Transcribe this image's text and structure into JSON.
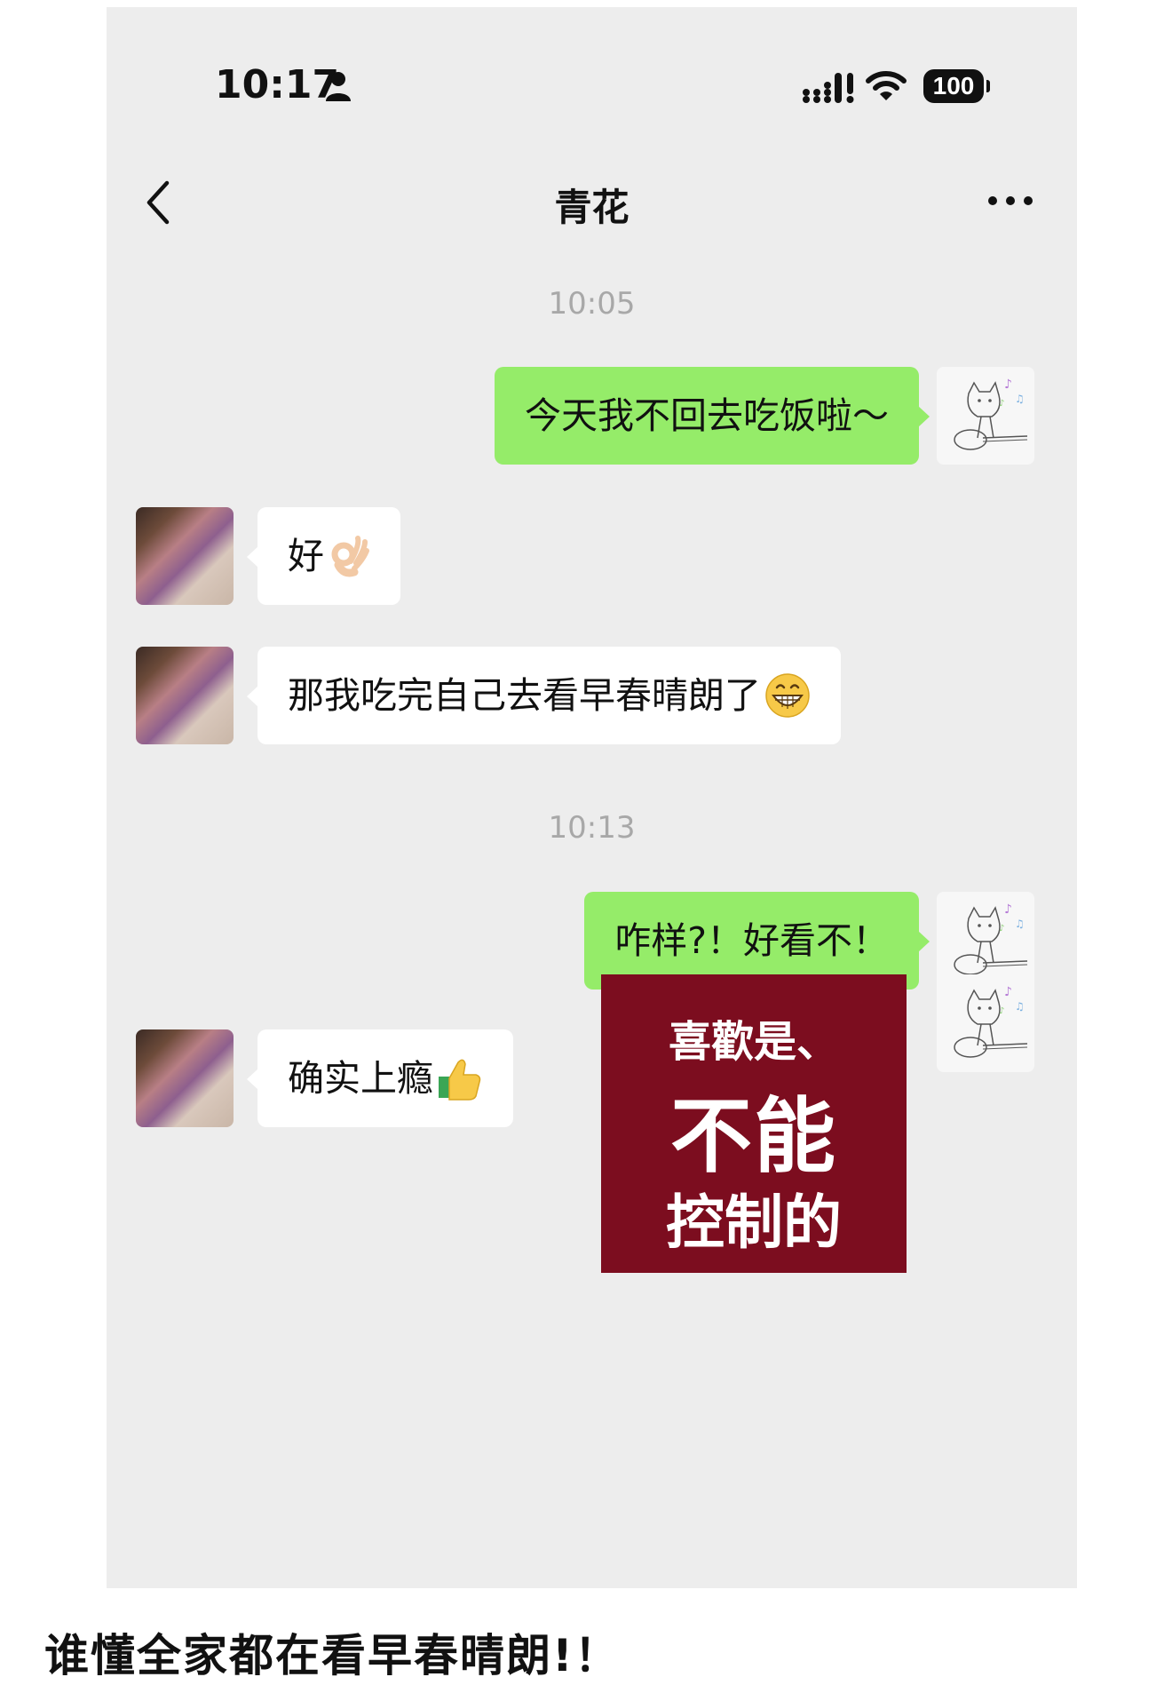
{
  "status_bar": {
    "time": "10:17",
    "battery": "100"
  },
  "nav": {
    "title": "青花"
  },
  "messages": [
    {
      "type": "timestamp",
      "text": "10:05"
    },
    {
      "type": "sent",
      "text": "今天我不回去吃饭啦～"
    },
    {
      "type": "received",
      "text": "好",
      "emoji": "ok-hand"
    },
    {
      "type": "received",
      "text": "那我吃完自己去看早春晴朗了",
      "emoji": "grinning-face"
    },
    {
      "type": "timestamp",
      "text": "10:13"
    },
    {
      "type": "sent",
      "text": "咋样?！好看不！"
    },
    {
      "type": "received",
      "text": "确实上瘾",
      "emoji": "thumbs-up"
    },
    {
      "type": "sent-sticker",
      "lines": [
        "喜歡是、",
        "不能",
        "控制的"
      ]
    }
  ],
  "caption": "谁懂全家都在看早春晴朗!！",
  "colors": {
    "chat_background": "#ededed",
    "sent_bubble": "#95ec69",
    "received_bubble": "#ffffff",
    "sticker_background": "#7c0d1f",
    "timestamp_text": "#a8a8a8"
  }
}
